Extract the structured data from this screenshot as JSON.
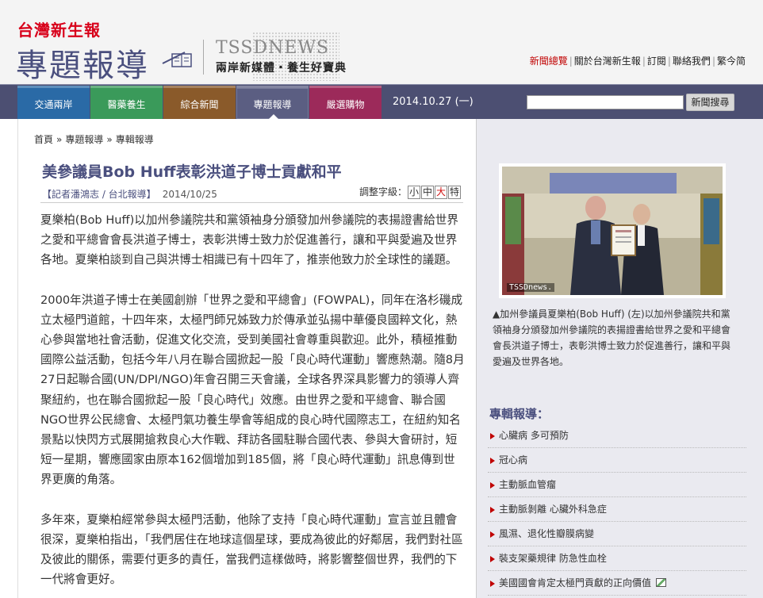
{
  "header": {
    "logo_small": "台灣新生報",
    "logo_big": "專題報導",
    "brand": "TSSDNEWS",
    "slogan": "兩岸新媒體・養生好寶典",
    "links": [
      "新聞總覽",
      "關於台灣新生報",
      "訂閱",
      "聯絡我們",
      "繁今简"
    ]
  },
  "nav": {
    "tabs": [
      {
        "label": "交通兩岸",
        "color": "#2a6aa6"
      },
      {
        "label": "醫藥養生",
        "color": "#3a9a5a"
      },
      {
        "label": "綜合新聞",
        "color": "#8a5a2a"
      },
      {
        "label": "專題報導",
        "color": "#5b5e82"
      },
      {
        "label": "嚴選購物",
        "color": "#9c2a5a"
      }
    ],
    "date": "2014.10.27 (一)",
    "search_placeholder": "",
    "search_button": "新聞搜尋"
  },
  "breadcrumb": [
    "首頁",
    "專題報導",
    "專輯報導"
  ],
  "article": {
    "title": "美參議員Bob Huff表彰洪道子博士貢獻和平",
    "byline": "【記者潘鴻志 / 台北報導】",
    "date": "2014/10/25",
    "fontsize_label": "調整字級：",
    "fontsizes": [
      "小",
      "中",
      "大",
      "特"
    ],
    "paragraphs": [
      "夏樂柏(Bob Huff)以加州參議院共和黨領袖身分頒發加州參議院的表揚證書給世界之愛和平總會會長洪道子博士，表彰洪博士致力於促進善行，讓和平與愛遍及世界各地。夏樂柏談到自己與洪博士相識已有十四年了，推崇他致力於全球性的議題。",
      "2000年洪道子博士在美國創辦「世界之愛和平總會」(FOWPAL)，同年在洛杉磯成立太極門道館，十四年來，太極門師兄姊致力於傳承並弘揚中華優良國粹文化，熱心參與當地社會活動，促進文化交流，受到美國社會尊重與歡迎。此外，積極推動國際公益活動，包括今年八月在聯合國掀起一股「良心時代運動」響應熱潮。隨8月27日起聯合國(UN/DPI/NGO)年會召開三天會議，全球各界深具影響力的領導人齊聚紐約，也在聯合國掀起一股「良心時代」效應。由世界之愛和平總會、聯合國NGO世界公民總會、太極門氣功養生學會等組成的良心時代國際志工，在紐約知名景點以快閃方式展開搶救良心大作戰、拜訪各國駐聯合國代表、參與大會研討，短短一星期，響應國家由原本162個增加到185個，將「良心時代運動」訊息傳到世界更廣的角落。",
      "多年來，夏樂柏經常參與太極門活動，他除了支持「良心時代運動」宣言並且體會很深，夏樂柏指出，「我們居住在地球這個星球，要成為彼此的好鄰居，我們對社區及彼此的關係，需要付更多的責任，當我們這樣做時，將影響整個世界，我們的下一代將會更好。"
    ]
  },
  "sidebar": {
    "photo_tag": "TSSDnews.",
    "caption": "▲加州參議員夏樂柏(Bob Huff) (左)以加州參議院共和黨領袖身分頒發加州參議院的表揚證書給世界之愛和平總會會長洪道子博士，表彰洪博士致力於促進善行，讓和平與愛遍及世界各地。",
    "related_title": "專輯報導：",
    "related": [
      "心臟病 多可預防",
      "冠心病",
      "主動脈血管瘤",
      "主動脈剝離 心臟外科急症",
      "風濕、退化性瓣膜病變",
      "裝支架藥規律 防急性血栓",
      "美國國會肯定太極門貢獻的正向價值"
    ]
  },
  "colors": {
    "brand_red": "#d8001a",
    "brand_navy": "#4a4f7e",
    "nav_bg": "#4c4f72"
  }
}
